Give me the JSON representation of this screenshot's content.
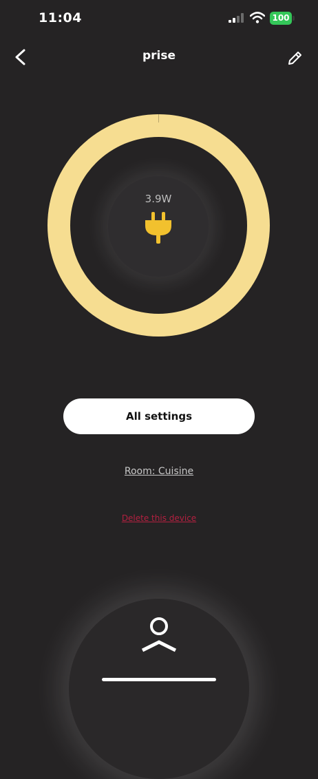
{
  "status_bar": {
    "time": "11:04",
    "battery_level": "100",
    "battery_color": "#34c759"
  },
  "nav": {
    "title": "prise",
    "back_icon": "chevron-left-icon",
    "edit_icon": "pencil-icon"
  },
  "device": {
    "power_reading": "3.9W",
    "icon": "plug-icon",
    "ring_color": "#f6dd91",
    "plug_color": "#f2c12e"
  },
  "actions": {
    "all_settings_label": "All settings",
    "room_label": "Room: Cuisine",
    "delete_label": "Delete this device",
    "delete_color": "#b32040"
  },
  "bottom_nav": {
    "icon": "user-icon"
  }
}
